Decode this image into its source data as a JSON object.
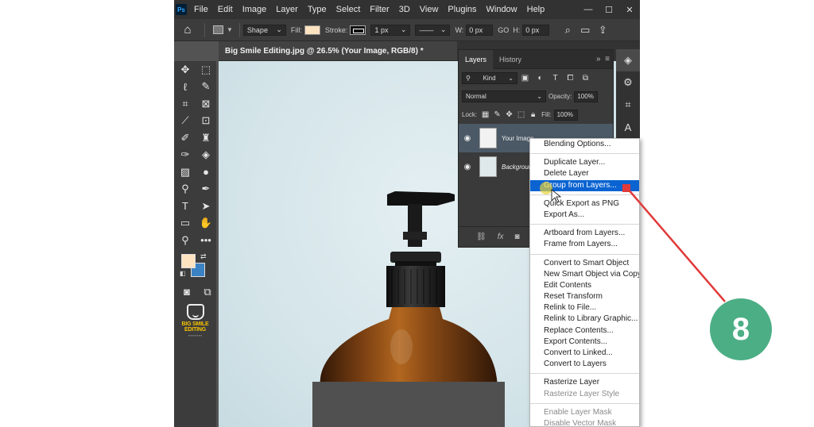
{
  "app": {
    "logo": "Ps",
    "menu": [
      "File",
      "Edit",
      "Image",
      "Layer",
      "Type",
      "Select",
      "Filter",
      "3D",
      "View",
      "Plugins",
      "Window",
      "Help"
    ],
    "window_controls": [
      "—",
      "☐",
      "✕"
    ]
  },
  "options_bar": {
    "home_icon": "home-icon",
    "mode": "Shape",
    "fill_label": "Fill:",
    "fill_color": "#fde3c0",
    "stroke_label": "Stroke:",
    "stroke_width": "1 px",
    "w_label": "W:",
    "w_value": "0 px",
    "go_label": "GO",
    "h_label": "H:",
    "h_value": "0 px"
  },
  "document": {
    "tab_title": "Big Smile Editing.jpg @ 26.5% (Your Image, RGB/8) *",
    "background_color": "#d7e6ea"
  },
  "toolbar": {
    "foreground_color": "#fde3c0",
    "background_color": "#3b82c4",
    "logo_text": "BIG SMILE EDITING",
    "tools": [
      "move-icon",
      "marquee-icon",
      "lasso-icon",
      "quick-select-icon",
      "crop-icon",
      "frame-icon",
      "eyedropper-icon",
      "spot-heal-icon",
      "brush-icon",
      "stamp-icon",
      "history-brush-icon",
      "eraser-icon",
      "gradient-icon",
      "blur-icon",
      "dodge-icon",
      "pen-icon",
      "type-icon",
      "path-select-icon",
      "rectangle-icon",
      "hand-icon",
      "zoom-icon",
      "more-icon"
    ]
  },
  "layers_panel": {
    "tabs": [
      "Layers",
      "History"
    ],
    "filter_kind": "Kind",
    "blend_mode": "Normal",
    "opacity_label": "Opacity:",
    "opacity_value": "100%",
    "lock_label": "Lock:",
    "fill_label": "Fill:",
    "fill_value": "100%",
    "layers": [
      {
        "name": "Your Image",
        "selected": true
      },
      {
        "name": "Background",
        "selected": false
      }
    ],
    "footer_icons": [
      "link-icon",
      "fx-icon",
      "mask-icon"
    ],
    "footer_fx": "fx"
  },
  "context_menu": {
    "groups": [
      [
        {
          "label": "Blending Options...",
          "state": "normal"
        }
      ],
      [
        {
          "label": "Duplicate Layer...",
          "state": "normal"
        },
        {
          "label": "Delete Layer",
          "state": "normal"
        },
        {
          "label": "Group from Layers...",
          "state": "highlighted"
        }
      ],
      [
        {
          "label": "Quick Export as PNG",
          "state": "normal"
        },
        {
          "label": "Export As...",
          "state": "normal"
        }
      ],
      [
        {
          "label": "Artboard from Layers...",
          "state": "normal"
        },
        {
          "label": "Frame from Layers...",
          "state": "normal"
        }
      ],
      [
        {
          "label": "Convert to Smart Object",
          "state": "normal"
        },
        {
          "label": "New Smart Object via Copy",
          "state": "normal"
        },
        {
          "label": "Edit Contents",
          "state": "normal"
        },
        {
          "label": "Reset Transform",
          "state": "normal"
        },
        {
          "label": "Relink to File...",
          "state": "normal"
        },
        {
          "label": "Relink to Library Graphic...",
          "state": "normal"
        },
        {
          "label": "Replace Contents...",
          "state": "normal"
        },
        {
          "label": "Export Contents...",
          "state": "normal"
        },
        {
          "label": "Convert to Linked...",
          "state": "normal"
        },
        {
          "label": "Convert to Layers",
          "state": "normal"
        }
      ],
      [
        {
          "label": "Rasterize Layer",
          "state": "normal"
        },
        {
          "label": "Rasterize Layer Style",
          "state": "disabled"
        }
      ],
      [
        {
          "label": "Enable Layer Mask",
          "state": "disabled"
        },
        {
          "label": "Disable Vector Mask",
          "state": "disabled"
        }
      ]
    ]
  },
  "annotation": {
    "step_number": "8",
    "badge_color": "#4cae85",
    "arrow_color": "#e03a3a"
  }
}
